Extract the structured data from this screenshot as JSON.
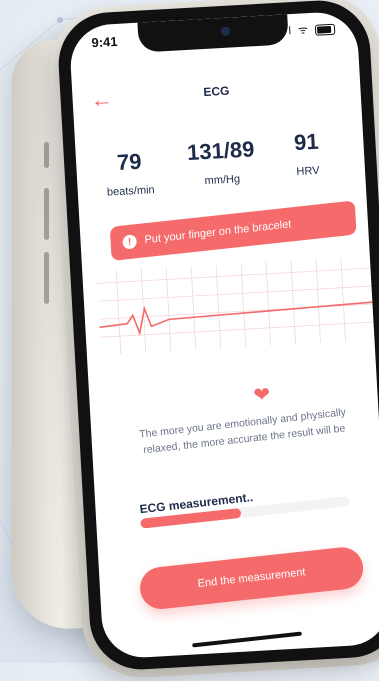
{
  "status_bar": {
    "time": "9:41",
    "icons": "ıl ᯤ"
  },
  "header": {
    "title": "ECG",
    "back_icon": "arrow-left-icon"
  },
  "stats": [
    {
      "value": "79",
      "unit": "beats/min"
    },
    {
      "value": "131/89",
      "unit": "mm/Hg"
    },
    {
      "value": "91",
      "unit": "HRV"
    }
  ],
  "alert": {
    "icon": "exclamation-icon",
    "text": "Put your finger on the bracelet"
  },
  "heart_icon": "heart-icon",
  "hint_text": "The more you are emotionally and physically relaxed, the more accurate the result will be",
  "measurement": {
    "label": "ECG measurement..",
    "progress": 0.48
  },
  "end_button": {
    "label": "End the measurement"
  },
  "colors": {
    "accent": "#f56a6a",
    "text_dark": "#1e2a4a",
    "text_muted": "#6c7488"
  }
}
